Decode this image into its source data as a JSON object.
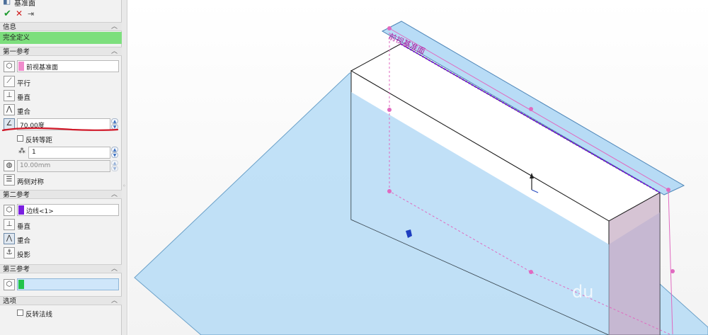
{
  "feature": {
    "title": "基准面",
    "ok_symbol": "✔",
    "cancel_symbol": "✕",
    "pin_symbol": "⇥"
  },
  "info": {
    "header": "信息",
    "status": "完全定义",
    "status_color": "#7ddf7d"
  },
  "ref1": {
    "header": "第一参考",
    "selection": "前视基准面",
    "selection_color": "#f08ccc",
    "options": {
      "parallel": "平行",
      "perpendicular": "垂直",
      "coincident": "重合"
    },
    "angle_value": "70.00度",
    "flip_offset_label": "反转等距",
    "instances_value": "1",
    "distance_value": "10.00mm",
    "mid_plane_label": "两侧对称"
  },
  "ref2": {
    "header": "第二参考",
    "selection": "边线<1>",
    "selection_color": "#7a1fe0",
    "options": {
      "perpendicular": "垂直",
      "coincident": "重合",
      "projection": "投影"
    }
  },
  "ref3": {
    "header": "第三参考",
    "selection": "",
    "selection_color": "#22c34a"
  },
  "options": {
    "header": "选项",
    "flip_normal_label": "反转法线"
  },
  "viewport": {
    "plane_label": "前视基准面",
    "annotation_color": "#d11a2a"
  }
}
